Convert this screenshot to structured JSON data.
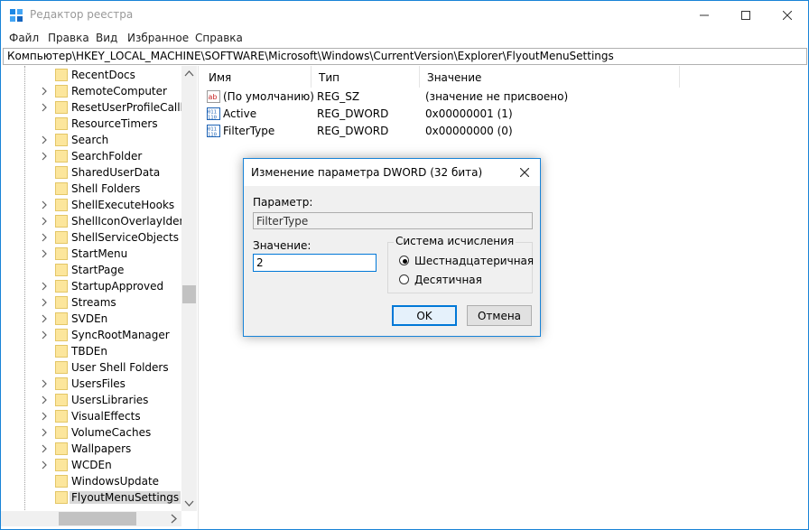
{
  "window": {
    "title": "Редактор реестра",
    "accent": "#1883d7"
  },
  "menu": [
    "Файл",
    "Правка",
    "Вид",
    "Избранное",
    "Справка"
  ],
  "address": "Компьютер\\HKEY_LOCAL_MACHINE\\SOFTWARE\\Microsoft\\Windows\\CurrentVersion\\Explorer\\FlyoutMenuSettings",
  "tree": {
    "items": [
      {
        "label": "RecentDocs",
        "expandable": false
      },
      {
        "label": "RemoteComputer",
        "expandable": true
      },
      {
        "label": "ResetUserProfileCallba",
        "expandable": true
      },
      {
        "label": "ResourceTimers",
        "expandable": false
      },
      {
        "label": "Search",
        "expandable": true
      },
      {
        "label": "SearchFolder",
        "expandable": true
      },
      {
        "label": "SharedUserData",
        "expandable": false
      },
      {
        "label": "Shell Folders",
        "expandable": false
      },
      {
        "label": "ShellExecuteHooks",
        "expandable": true
      },
      {
        "label": "ShellIconOverlayIdentii",
        "expandable": true
      },
      {
        "label": "ShellServiceObjects",
        "expandable": true
      },
      {
        "label": "StartMenu",
        "expandable": true
      },
      {
        "label": "StartPage",
        "expandable": false
      },
      {
        "label": "StartupApproved",
        "expandable": true
      },
      {
        "label": "Streams",
        "expandable": true
      },
      {
        "label": "SVDEn",
        "expandable": true
      },
      {
        "label": "SyncRootManager",
        "expandable": true
      },
      {
        "label": "TBDEn",
        "expandable": false
      },
      {
        "label": "User Shell Folders",
        "expandable": false
      },
      {
        "label": "UsersFiles",
        "expandable": true
      },
      {
        "label": "UsersLibraries",
        "expandable": true
      },
      {
        "label": "VisualEffects",
        "expandable": true
      },
      {
        "label": "VolumeCaches",
        "expandable": true
      },
      {
        "label": "Wallpapers",
        "expandable": true
      },
      {
        "label": "WCDEn",
        "expandable": true
      },
      {
        "label": "WindowsUpdate",
        "expandable": false
      },
      {
        "label": "FlyoutMenuSettings",
        "expandable": false,
        "selected": true
      }
    ]
  },
  "list": {
    "columns": [
      "Имя",
      "Тип",
      "Значение"
    ],
    "rows": [
      {
        "icon": "string-value-icon",
        "name": "(По умолчанию)",
        "type": "REG_SZ",
        "value": "(значение не присвоено)"
      },
      {
        "icon": "dword-value-icon",
        "name": "Active",
        "type": "REG_DWORD",
        "value": "0x00000001 (1)"
      },
      {
        "icon": "dword-value-icon",
        "name": "FilterType",
        "type": "REG_DWORD",
        "value": "0x00000000 (0)"
      }
    ]
  },
  "dialog": {
    "title": "Изменение параметра DWORD (32 бита)",
    "param_label": "Параметр:",
    "param_value": "FilterType",
    "value_label": "Значение:",
    "value": "2",
    "base_group": "Система исчисления",
    "radio_hex": "Шестнадцатеричная",
    "radio_dec": "Десятичная",
    "selected_base": "hex",
    "ok": "OK",
    "cancel": "Отмена"
  }
}
